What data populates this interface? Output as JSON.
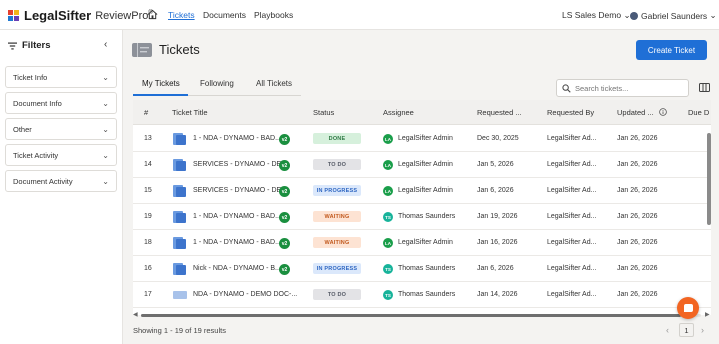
{
  "app": {
    "brand": "LegalSifter",
    "product": "ReviewPro",
    "trademark": "®"
  },
  "nav": {
    "links": [
      {
        "label": "Tickets",
        "active": true
      },
      {
        "label": "Documents",
        "active": false
      },
      {
        "label": "Playbooks",
        "active": false
      }
    ],
    "org": "LS Sales Demo",
    "user": "Gabriel Saunders"
  },
  "sidebar": {
    "title": "Filters",
    "collapse_glyph": "‹",
    "filters": [
      "Ticket Info",
      "Document Info",
      "Other",
      "Ticket Activity",
      "Document Activity"
    ]
  },
  "main": {
    "title": "Tickets",
    "create_label": "Create Ticket",
    "tabs": [
      "My Tickets",
      "Following",
      "All Tickets"
    ],
    "search_placeholder": "Search tickets...",
    "columns": [
      "#",
      "Ticket Title",
      "Status",
      "Assignee",
      "Requested ...",
      "Requested By",
      "Updated ...",
      "Due D"
    ],
    "rows": [
      {
        "num": "13",
        "title": "1 - NDA - DYNAMO - BAD...",
        "version": "v2",
        "status": "DONE",
        "assignee_initials": "LA",
        "assignee": "LegalSifter Admin",
        "requested": "Dec 30, 2025",
        "requested_by": "LegalSifter Ad...",
        "updated": "Jan 26, 2026",
        "doc_style": "blue"
      },
      {
        "num": "14",
        "title": "SERVICES - DYNAMO - DE...",
        "version": "v2",
        "status": "TO DO",
        "assignee_initials": "LA",
        "assignee": "LegalSifter Admin",
        "requested": "Jan 5, 2026",
        "requested_by": "LegalSifter Ad...",
        "updated": "Jan 26, 2026",
        "doc_style": "blue"
      },
      {
        "num": "15",
        "title": "SERVICES - DYNAMO - DE...",
        "version": "v2",
        "status": "IN PROGRESS",
        "assignee_initials": "LA",
        "assignee": "LegalSifter Admin",
        "requested": "Jan 6, 2026",
        "requested_by": "LegalSifter Ad...",
        "updated": "Jan 26, 2026",
        "doc_style": "blue"
      },
      {
        "num": "19",
        "title": "1 - NDA - DYNAMO - BAD...",
        "version": "v2",
        "status": "WAITING",
        "assignee_initials": "TS",
        "assignee": "Thomas Saunders",
        "requested": "Jan 19, 2026",
        "requested_by": "LegalSifter Ad...",
        "updated": "Jan 26, 2026",
        "doc_style": "blue"
      },
      {
        "num": "18",
        "title": "1 - NDA - DYNAMO - BAD...",
        "version": "v2",
        "status": "WAITING",
        "assignee_initials": "LA",
        "assignee": "LegalSifter Admin",
        "requested": "Jan 16, 2026",
        "requested_by": "LegalSifter Ad...",
        "updated": "Jan 26, 2026",
        "doc_style": "blue"
      },
      {
        "num": "16",
        "title": "Nick - NDA - DYNAMO - B...",
        "version": "v2",
        "status": "IN PROGRESS",
        "assignee_initials": "TS",
        "assignee": "Thomas Saunders",
        "requested": "Jan 6, 2026",
        "requested_by": "LegalSifter Ad...",
        "updated": "Jan 26, 2026",
        "doc_style": "blue"
      },
      {
        "num": "17",
        "title": "NDA - DYNAMO - DEMO DOC-...",
        "version": "",
        "status": "TO DO",
        "assignee_initials": "TS",
        "assignee": "Thomas Saunders",
        "requested": "Jan 14, 2026",
        "requested_by": "LegalSifter Ad...",
        "updated": "Jan 26, 2026",
        "doc_style": "gray"
      }
    ],
    "showing": "Showing 1 - 19 of 19 results",
    "page": "1"
  },
  "colors": {
    "accent": "#1f6fd6",
    "status": {
      "DONE": {
        "bg": "#d6f0dc",
        "fg": "#2f7a45"
      },
      "TO DO": {
        "bg": "#e3e3e6",
        "fg": "#555a66"
      },
      "IN PROGRESS": {
        "bg": "#dbe8fb",
        "fg": "#2e66c2"
      },
      "WAITING": {
        "bg": "#fde3d3",
        "fg": "#c25a1f"
      }
    },
    "avatar": {
      "LA": "#1a9e4a",
      "TS": "#17b39a"
    },
    "chat": "#f26522"
  },
  "icons": [
    "home-icon",
    "filter-icon",
    "chevron-down-icon",
    "ticket-icon",
    "search-icon",
    "columns-icon",
    "document-icon",
    "info-icon",
    "user-icon",
    "chat-icon"
  ]
}
